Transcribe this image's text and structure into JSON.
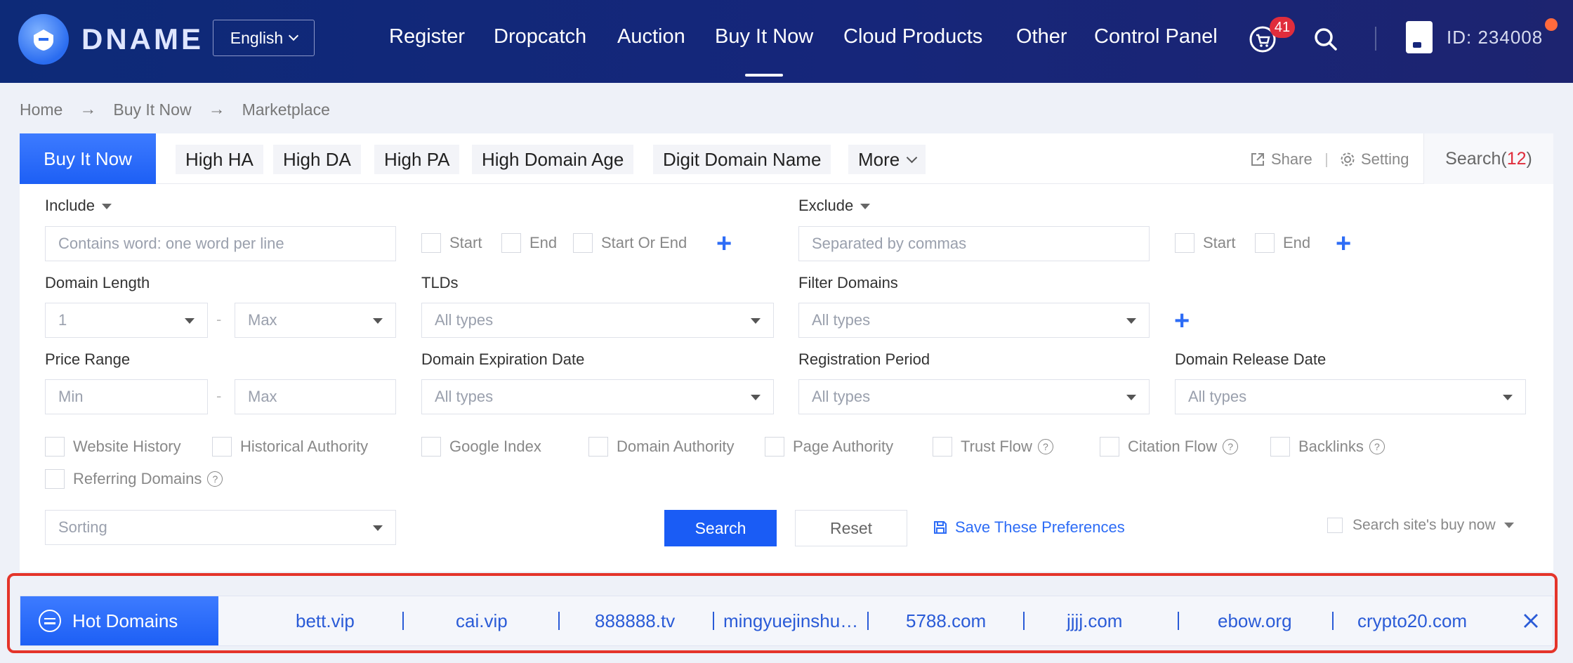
{
  "header": {
    "brand": "DNAME",
    "language": "English",
    "nav": [
      "Register",
      "Dropcatch",
      "Auction",
      "Buy It Now",
      "Cloud Products",
      "Other",
      "Control Panel"
    ],
    "cart_count": "41",
    "user_id": "ID: 234008"
  },
  "breadcrumb": [
    "Home",
    "Buy It Now",
    "Marketplace"
  ],
  "tabs": {
    "primary": "Buy It Now",
    "chips": [
      "High HA",
      "High DA",
      "High PA",
      "High Domain Age",
      "Digit Domain Name"
    ],
    "more": "More",
    "share": "Share",
    "setting": "Setting",
    "search_label": "Search(",
    "search_count": "12",
    "search_close": ")"
  },
  "filters": {
    "include_label": "Include",
    "include_placeholder": "Contains word: one word per line",
    "include_opts": [
      "Start",
      "End",
      "Start Or End"
    ],
    "exclude_label": "Exclude",
    "exclude_placeholder": "Separated by commas",
    "exclude_opts": [
      "Start",
      "End"
    ],
    "domain_length_label": "Domain Length",
    "length_min": "1",
    "length_max": "Max",
    "tlds_label": "TLDs",
    "tlds_value": "All types",
    "filter_domains_label": "Filter Domains",
    "filter_domains_value": "All types",
    "price_range_label": "Price Range",
    "price_min": "Min",
    "price_max": "Max",
    "expiration_label": "Domain Expiration Date",
    "expiration_value": "All types",
    "registration_label": "Registration Period",
    "registration_value": "All types",
    "release_label": "Domain Release Date",
    "release_value": "All types",
    "checks": [
      "Website History",
      "Historical Authority",
      "Google Index",
      "Domain Authority",
      "Page Authority",
      "Trust Flow",
      "Citation Flow",
      "Backlinks",
      "Referring Domains"
    ],
    "dash": "-",
    "sorting": "Sorting",
    "search_btn": "Search",
    "reset_btn": "Reset",
    "save_pref": "Save These Preferences",
    "site_buy": "Search site's buy now"
  },
  "hot": {
    "title": "Hot Domains",
    "items": [
      "bett.vip",
      "cai.vip",
      "888888.tv",
      "mingyuejinshu…",
      "5788.com",
      "jjjj.com",
      "ebow.org",
      "crypto20.com"
    ]
  },
  "colors": {
    "header": "#16267a",
    "primary": "#1d5ff5",
    "accent_red": "#e02d3c",
    "link": "#2a5bd7"
  }
}
